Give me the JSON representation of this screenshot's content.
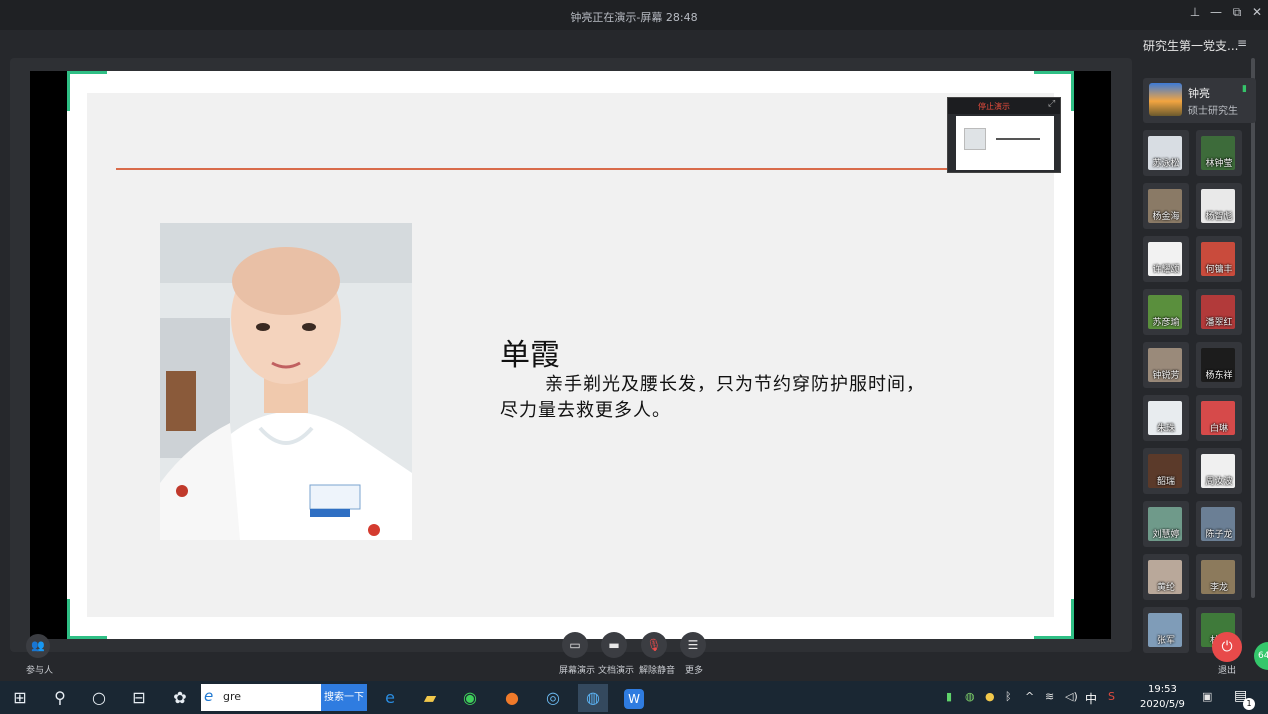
{
  "window": {
    "title": "钟亮正在演示-屏幕 28:48",
    "controls": [
      "pin-icon",
      "minimize-icon",
      "restore-icon",
      "close-icon"
    ]
  },
  "slide": {
    "name": "单霞",
    "text_line1": "亲手剃光及腰长发，只为节约穿防护服时间，",
    "text_line2": "尽力量去救更多人。"
  },
  "mini_preview": {
    "stop_label": "停止演示"
  },
  "toolbar": {
    "participants_label": "参与人",
    "items": [
      {
        "label": "屏幕演示",
        "icon": "screen-share-icon"
      },
      {
        "label": "文档演示",
        "icon": "folder-icon"
      },
      {
        "label": "解除静音",
        "icon": "mic-muted-icon"
      },
      {
        "label": "更多",
        "icon": "menu-icon"
      }
    ],
    "exit_label": "退出",
    "badge": "64"
  },
  "panel": {
    "title": "研究生第一党支...",
    "host": {
      "name": "钟亮",
      "role": "硕士研究生"
    },
    "participants": [
      {
        "name": "苏泳松",
        "color": "#d8dde3"
      },
      {
        "name": "林钟莹",
        "color": "#3d6b3a"
      },
      {
        "name": "杨金海",
        "color": "#8a7a66"
      },
      {
        "name": "杨智彪",
        "color": "#e9e9e9"
      },
      {
        "name": "许耀颂",
        "color": "#f2f2f2"
      },
      {
        "name": "何镛丰",
        "color": "#c94b3c"
      },
      {
        "name": "苏彦瑜",
        "color": "#5a8f3d"
      },
      {
        "name": "潘翠红",
        "color": "#b23a3a"
      },
      {
        "name": "钟锐芳",
        "color": "#9a8a7a"
      },
      {
        "name": "杨东祥",
        "color": "#1c1c1c"
      },
      {
        "name": "朱珠",
        "color": "#e8ecef"
      },
      {
        "name": "白琳",
        "color": "#d64a4a"
      },
      {
        "name": "韶瑞",
        "color": "#5b3a2a"
      },
      {
        "name": "周汝波",
        "color": "#f0f0f0"
      },
      {
        "name": "刘慧婷",
        "color": "#6f9a8a"
      },
      {
        "name": "陈子龙",
        "color": "#6b7f95"
      },
      {
        "name": "黄纶",
        "color": "#b9a89a"
      },
      {
        "name": "李龙",
        "color": "#8c7a5c"
      },
      {
        "name": "张军",
        "color": "#7f9cb8"
      },
      {
        "name": "林巧",
        "color": "#3f7a3a"
      }
    ]
  },
  "taskbar": {
    "search_value": "gre",
    "search_button": "搜索一下",
    "ime": "中",
    "time": "19:53",
    "date": "2020/5/9",
    "notification_count": "1"
  }
}
